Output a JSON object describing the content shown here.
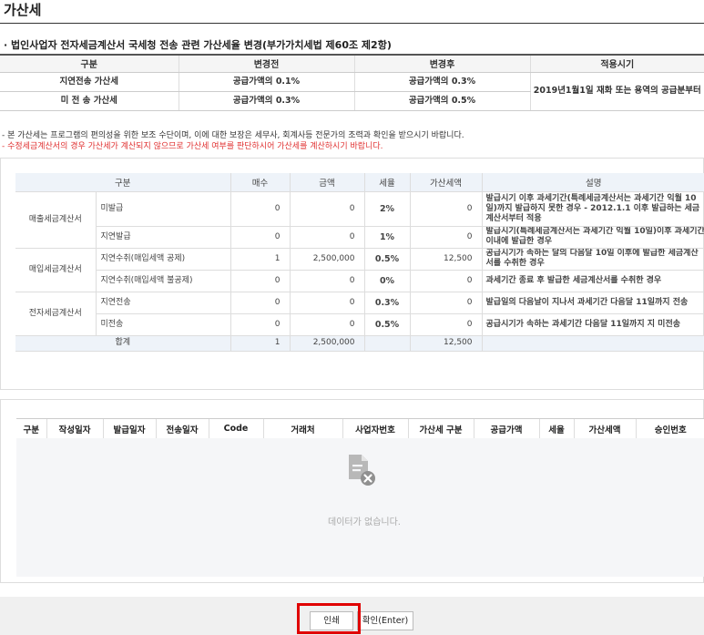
{
  "page_title": "가산세",
  "section_heading": "· 법인사업자 전자세금계산서 국세청 전송 관련 가산세율 변경(부가가치세법 제60조 제2항)",
  "rate_table": {
    "headers": [
      "구분",
      "변경전",
      "변경후",
      "적용시기"
    ],
    "rows": [
      [
        "지연전송 가산세",
        "공급가액의 0.1%",
        "공급가액의 0.3%"
      ],
      [
        "미 전 송 가산세",
        "공급가액의 0.3%",
        "공급가액의 0.5%"
      ]
    ],
    "apply_period": "2019년1월1일 재화 또는 용역의 공급분부터"
  },
  "notes": {
    "line1": "- 본 가산세는 프로그램의 편의성을 위한 보조 수단이며, 이에 대한 보장은 세무사, 회계사등 전문가의 조력과 확인을 받으시기 바랍니다.",
    "line2": "- 수정세금계산서의 경우 가산세가 계산되지 않으므로 가산세 여부를 판단하시어 가산세를 계산하시기 바랍니다."
  },
  "summary": {
    "headers": [
      "구분",
      "매수",
      "금액",
      "세율",
      "가산세액",
      "설명"
    ],
    "groups": [
      "매출세금계산서",
      "매입세금계산서",
      "전자세금계산서"
    ],
    "rows": [
      {
        "item": "미발급",
        "count": "0",
        "amount": "0",
        "rate": "2%",
        "tax": "0",
        "desc": "발급시기 이후 과세기간(특례세금계산서는 과세기간 익월 10일)까지 발급하지 못한 경우 - 2012.1.1 이후 발급하는 세금계산서부터 적용"
      },
      {
        "item": "지연발급",
        "count": "0",
        "amount": "0",
        "rate": "1%",
        "tax": "0",
        "desc": "발급시기(특례세금계산서는 과세기간 익월 10일)이후 과세기간 이내에 발급한 경우"
      },
      {
        "item": "지연수취(매입세액 공제)",
        "count": "1",
        "amount": "2,500,000",
        "rate": "0.5%",
        "tax": "12,500",
        "desc": "공급시기가 속하는 달의 다음달 10일 이후에 발급한 세금계산서를 수취한 경우"
      },
      {
        "item": "지연수취(매입세액 불공제)",
        "count": "0",
        "amount": "0",
        "rate": "0%",
        "tax": "0",
        "desc": "과세기간 종료 후 발급한 세금계산서를 수취한 경우"
      },
      {
        "item": "지연전송",
        "count": "0",
        "amount": "0",
        "rate": "0.3%",
        "tax": "0",
        "desc": "발급일의 다음날이 지나서 과세기간 다음달 11일까지 전송"
      },
      {
        "item": "미전송",
        "count": "0",
        "amount": "0",
        "rate": "0.5%",
        "tax": "0",
        "desc": "공급시기가 속하는 과세기간 다음달 11일까지 지 미전송"
      }
    ],
    "total": {
      "label": "합계",
      "count": "1",
      "amount": "2,500,000",
      "tax": "12,500"
    }
  },
  "detail": {
    "headers": [
      "구분",
      "작성일자",
      "발급일자",
      "전송일자",
      "Code",
      "거래처",
      "사업자번호",
      "가산세 구분",
      "공급가액",
      "세율",
      "가산세액",
      "승인번호"
    ],
    "empty_text": "데이터가 없습니다."
  },
  "footer": {
    "print_label": "인쇄",
    "confirm_label": "확인(Enter)"
  },
  "colors": {
    "highlight": "#e00000",
    "note_red": "#e03030",
    "header_bg": "#eef3f9"
  },
  "icons": {
    "empty": "document-x-icon"
  }
}
